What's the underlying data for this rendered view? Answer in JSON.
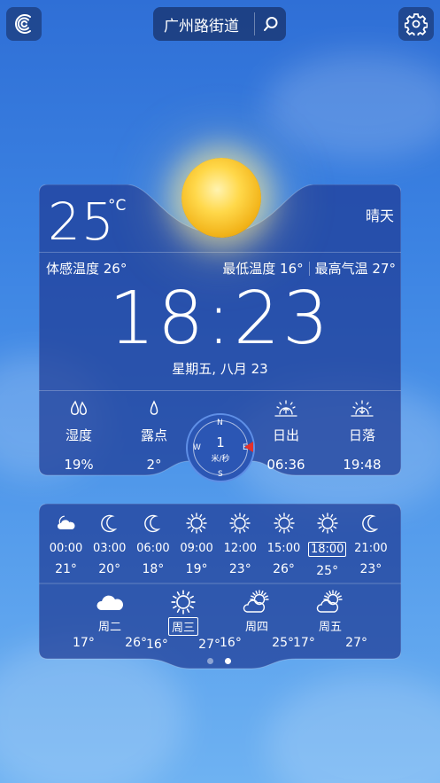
{
  "header": {
    "city": "广州路街道",
    "logo_icon": "app-logo-icon",
    "search_icon": "search-icon",
    "settings_icon": "gear-icon"
  },
  "current": {
    "temperature": "25",
    "unit": "°C",
    "condition": "晴天",
    "feels_like": "体感温度 26°",
    "min_temp": "最低温度 16°",
    "max_temp": "最高气温 27°",
    "time": "18:23",
    "date": "星期五, 八月 23"
  },
  "stats": {
    "humidity": {
      "label": "湿度",
      "value": "19%"
    },
    "dew_point": {
      "label": "露点",
      "value": "2°"
    },
    "sunrise": {
      "label": "日出",
      "value": "06:36"
    },
    "sunset": {
      "label": "日落",
      "value": "19:48"
    }
  },
  "wind": {
    "speed": "1",
    "unit": "米/秒",
    "n": "N",
    "s": "S",
    "w": "W",
    "e": "E"
  },
  "hourly": [
    {
      "time": "00:00",
      "temp": "21°",
      "icon": "partly-cloudy-night-icon"
    },
    {
      "time": "03:00",
      "temp": "20°",
      "icon": "moon-icon"
    },
    {
      "time": "06:00",
      "temp": "18°",
      "icon": "moon-icon"
    },
    {
      "time": "09:00",
      "temp": "19°",
      "icon": "sun-icon"
    },
    {
      "time": "12:00",
      "temp": "23°",
      "icon": "sun-icon"
    },
    {
      "time": "15:00",
      "temp": "26°",
      "icon": "sun-icon"
    },
    {
      "time": "18:00",
      "temp": "25°",
      "icon": "sun-icon",
      "selected": true
    },
    {
      "time": "21:00",
      "temp": "23°",
      "icon": "moon-icon"
    }
  ],
  "daily": [
    {
      "day": "周二",
      "low": "17°",
      "high": "26°",
      "icon": "cloud-icon"
    },
    {
      "day": "周三",
      "low": "16°",
      "high": "27°",
      "icon": "sun-icon",
      "selected": true
    },
    {
      "day": "周四",
      "low": "16°",
      "high": "25°",
      "icon": "partly-cloudy-icon"
    },
    {
      "day": "周五",
      "low": "17°",
      "high": "27°",
      "icon": "partly-cloudy-icon"
    }
  ],
  "pager": {
    "count": 2,
    "active": 1
  }
}
